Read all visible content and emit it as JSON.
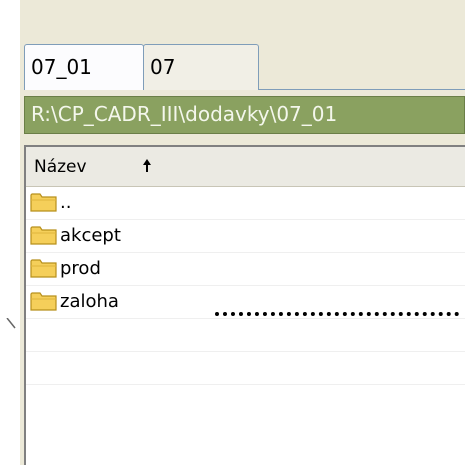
{
  "tabs": [
    {
      "label": "07_01",
      "active": true
    },
    {
      "label": "07",
      "active": false
    }
  ],
  "path_bar": {
    "text": "R:\\CP_CADR_III\\dodavky\\07_01"
  },
  "list": {
    "column_header": "Název",
    "sort_icon": "sort-up-arrow-icon",
    "rows": [
      {
        "name": "..",
        "icon": "folder-icon"
      },
      {
        "name": "akcept",
        "icon": "folder-icon"
      },
      {
        "name": "prod",
        "icon": "folder-icon"
      },
      {
        "name": "zaloha",
        "icon": "folder-icon"
      }
    ]
  },
  "colors": {
    "path_bar_bg": "#8aa160",
    "panel_bg": "#ece9d8",
    "folder": "#f5cf5a"
  }
}
